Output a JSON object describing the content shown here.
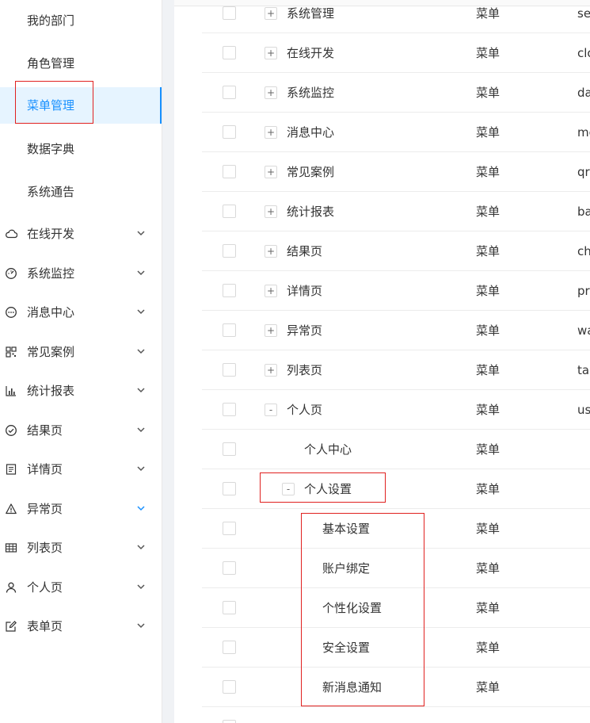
{
  "sidebar": {
    "sub_items": [
      "我的部门",
      "角色管理",
      "菜单管理",
      "数据字典",
      "系统通告"
    ],
    "active_sub_index": 2,
    "menus": [
      {
        "label": "在线开发",
        "icon": "cloud-icon"
      },
      {
        "label": "系统监控",
        "icon": "dashboard-icon"
      },
      {
        "label": "消息中心",
        "icon": "message-icon"
      },
      {
        "label": "常见案例",
        "icon": "qrcode-icon"
      },
      {
        "label": "统计报表",
        "icon": "bar-chart-icon"
      },
      {
        "label": "结果页",
        "icon": "check-circle-icon"
      },
      {
        "label": "详情页",
        "icon": "profile-icon"
      },
      {
        "label": "异常页",
        "icon": "warning-icon"
      },
      {
        "label": "列表页",
        "icon": "table-icon"
      },
      {
        "label": "个人页",
        "icon": "user-icon"
      },
      {
        "label": "表单页",
        "icon": "form-icon"
      }
    ],
    "highlight_color": "#1890ff",
    "annotation_color": "#e0211f"
  },
  "table": {
    "rows": [
      {
        "name": "系统管理",
        "expander": "+",
        "type": "菜单",
        "code": "se",
        "level": 0
      },
      {
        "name": "在线开发",
        "expander": "+",
        "type": "菜单",
        "code": "clo",
        "level": 0
      },
      {
        "name": "系统监控",
        "expander": "+",
        "type": "菜单",
        "code": "da",
        "level": 0
      },
      {
        "name": "消息中心",
        "expander": "+",
        "type": "菜单",
        "code": "me",
        "level": 0
      },
      {
        "name": "常见案例",
        "expander": "+",
        "type": "菜单",
        "code": "qr",
        "level": 0
      },
      {
        "name": "统计报表",
        "expander": "+",
        "type": "菜单",
        "code": "ba",
        "level": 0
      },
      {
        "name": "结果页",
        "expander": "+",
        "type": "菜单",
        "code": "ch",
        "level": 0
      },
      {
        "name": "详情页",
        "expander": "+",
        "type": "菜单",
        "code": "pr",
        "level": 0
      },
      {
        "name": "异常页",
        "expander": "+",
        "type": "菜单",
        "code": "wa",
        "level": 0
      },
      {
        "name": "列表页",
        "expander": "+",
        "type": "菜单",
        "code": "tal",
        "level": 0
      },
      {
        "name": "个人页",
        "expander": "-",
        "type": "菜单",
        "code": "us",
        "level": 0
      },
      {
        "name": "个人中心",
        "expander": "",
        "type": "菜单",
        "code": "",
        "level": 1
      },
      {
        "name": "个人设置",
        "expander": "-",
        "type": "菜单",
        "code": "",
        "level": 1
      },
      {
        "name": "基本设置",
        "expander": "",
        "type": "菜单",
        "code": "",
        "level": 2
      },
      {
        "name": "账户绑定",
        "expander": "",
        "type": "菜单",
        "code": "",
        "level": 2
      },
      {
        "name": "个性化设置",
        "expander": "",
        "type": "菜单",
        "code": "",
        "level": 2
      },
      {
        "name": "安全设置",
        "expander": "",
        "type": "菜单",
        "code": "",
        "level": 2
      },
      {
        "name": "新消息通知",
        "expander": "",
        "type": "菜单",
        "code": "",
        "level": 2
      }
    ]
  }
}
